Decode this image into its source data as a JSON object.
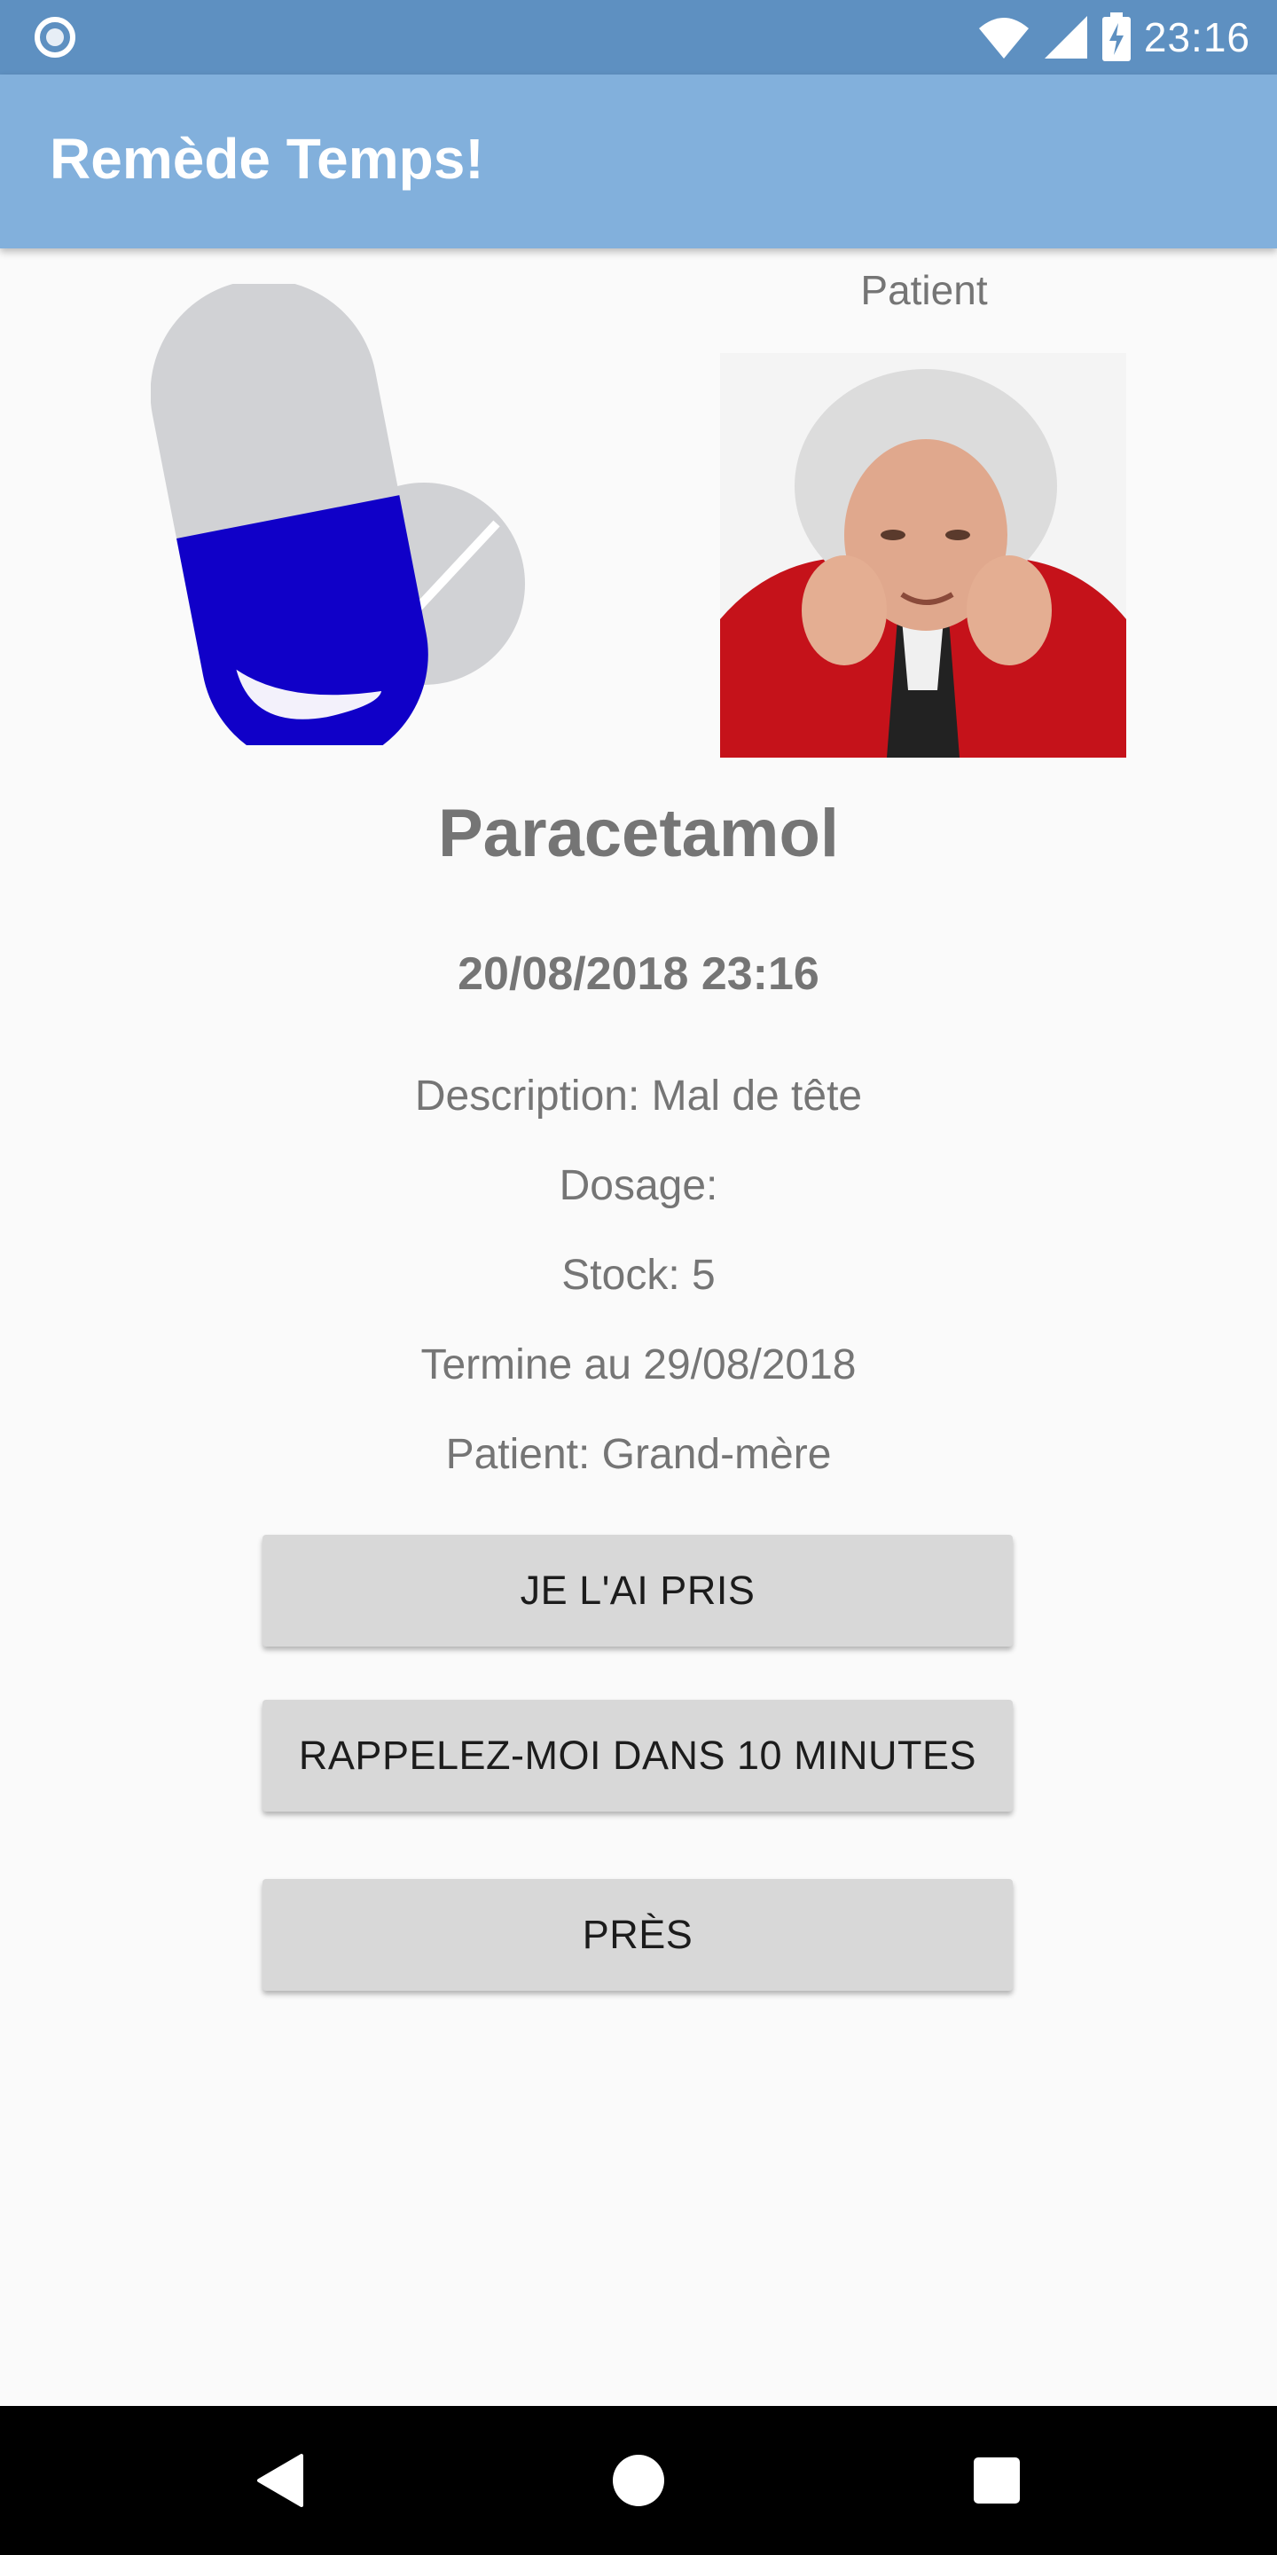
{
  "status_bar": {
    "time": "23:16",
    "left_icon": "notification-ring-icon",
    "icons": [
      "wifi-icon",
      "cell-signal-icon",
      "battery-charging-icon"
    ]
  },
  "app_bar": {
    "title": "Remède Temps!"
  },
  "patient": {
    "header": "Patient"
  },
  "medication": {
    "name": "Paracetamol",
    "datetime": "20/08/2018 23:16",
    "description": "Description: Mal de tête",
    "dosage": "Dosage:",
    "stock": "Stock: 5",
    "end_date": "Termine au 29/08/2018",
    "patient": "Patient: Grand-mère"
  },
  "actions": {
    "taken_label": "JE L'AI PRIS",
    "snooze_label": "RAPPELEZ-MOI DANS 10 MINUTES",
    "close_label": "PRÈS"
  },
  "colors": {
    "status_bar": "#5e90c1",
    "app_bar": "#82b0dc",
    "pill_blue": "#1000c8",
    "pill_grey": "#d1d2d5",
    "button_bg": "#d8d8d8",
    "text_grey": "#757575"
  },
  "nav_bar": {
    "icons": [
      "back-icon",
      "home-icon",
      "recents-icon"
    ]
  }
}
